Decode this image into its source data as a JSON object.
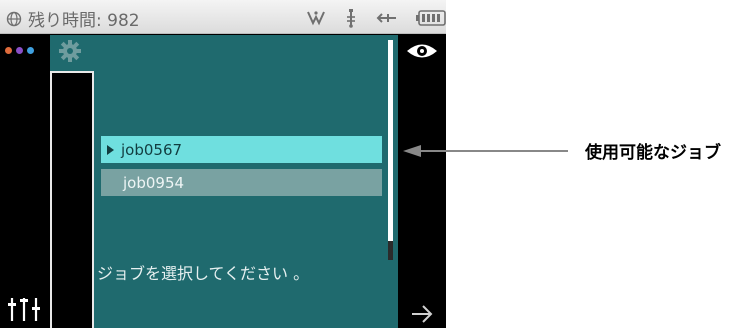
{
  "status": {
    "time_label": "残り時間: 982",
    "icons": [
      "globe-icon",
      "satellite-icon",
      "usb-icon",
      "battery-icon"
    ]
  },
  "toolbar": {
    "menu_dot_colors": [
      "#e06c3c",
      "#8a4fc7",
      "#3fa0e0"
    ],
    "settings_icon": "gear-icon",
    "adjust_icon": "sliders-icon"
  },
  "jobs": [
    {
      "label": "job0567",
      "selected": true
    },
    {
      "label": "job0954",
      "selected": false
    }
  ],
  "prompt": "ジョブを選択してください 。",
  "right": {
    "view_icon": "eye-icon",
    "next_icon": "arrow-right-icon"
  },
  "annotation": {
    "label": "使用可能なジョブ"
  },
  "colors": {
    "panel": "#1f6a6e",
    "selected_item": "#6fdfdf",
    "item": "#79a2a2"
  }
}
